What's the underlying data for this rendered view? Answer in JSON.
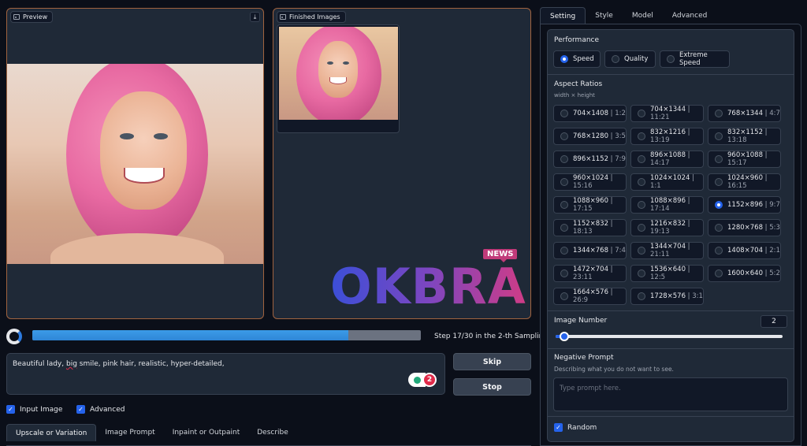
{
  "preview": {
    "label": "Preview"
  },
  "finished": {
    "label": "Finished Images"
  },
  "watermark": {
    "tag": "NEWS",
    "brand": "OKBRA"
  },
  "progress": {
    "fraction": 0.813,
    "step_text": "Step 17/30 in the 2-th Sampling"
  },
  "prompt": {
    "text_before": "Beautiful lady, ",
    "text_underlined": "big",
    "text_after": " smile, pink hair, realistic, hyper-detailed,",
    "badge_count": "2"
  },
  "buttons": {
    "skip": "Skip",
    "stop": "Stop"
  },
  "checks": {
    "input_image": "Input Image",
    "advanced": "Advanced"
  },
  "bottom_tabs": [
    "Upscale or Variation",
    "Image Prompt",
    "Inpaint or Outpaint",
    "Describe"
  ],
  "right_tabs": [
    "Setting",
    "Style",
    "Model",
    "Advanced"
  ],
  "performance": {
    "title": "Performance",
    "options": [
      "Speed",
      "Quality",
      "Extreme Speed"
    ],
    "selected": 0
  },
  "aspect": {
    "title": "Aspect Ratios",
    "subtitle": "width × height",
    "selected": 14,
    "options": [
      {
        "size": "704×1408",
        "ratio": "1:2"
      },
      {
        "size": "704×1344",
        "ratio": "11:21"
      },
      {
        "size": "768×1344",
        "ratio": "4:7"
      },
      {
        "size": "768×1280",
        "ratio": "3:5"
      },
      {
        "size": "832×1216",
        "ratio": "13:19"
      },
      {
        "size": "832×1152",
        "ratio": "13:18"
      },
      {
        "size": "896×1152",
        "ratio": "7:9"
      },
      {
        "size": "896×1088",
        "ratio": "14:17"
      },
      {
        "size": "960×1088",
        "ratio": "15:17"
      },
      {
        "size": "960×1024",
        "ratio": "15:16"
      },
      {
        "size": "1024×1024",
        "ratio": "1:1"
      },
      {
        "size": "1024×960",
        "ratio": "16:15"
      },
      {
        "size": "1088×960",
        "ratio": "17:15"
      },
      {
        "size": "1088×896",
        "ratio": "17:14"
      },
      {
        "size": "1152×896",
        "ratio": "9:7"
      },
      {
        "size": "1152×832",
        "ratio": "18:13"
      },
      {
        "size": "1216×832",
        "ratio": "19:13"
      },
      {
        "size": "1280×768",
        "ratio": "5:3"
      },
      {
        "size": "1344×768",
        "ratio": "7:4"
      },
      {
        "size": "1344×704",
        "ratio": "21:11"
      },
      {
        "size": "1408×704",
        "ratio": "2:1"
      },
      {
        "size": "1472×704",
        "ratio": "23:11"
      },
      {
        "size": "1536×640",
        "ratio": "12:5"
      },
      {
        "size": "1600×640",
        "ratio": "5:2"
      },
      {
        "size": "1664×576",
        "ratio": "26:9"
      },
      {
        "size": "1728×576",
        "ratio": "3:1"
      }
    ]
  },
  "image_number": {
    "title": "Image Number",
    "value": "2",
    "fraction": 0.03
  },
  "negative": {
    "title": "Negative Prompt",
    "subtitle": "Describing what you do not want to see.",
    "placeholder": "Type prompt here."
  },
  "random": {
    "label": "Random"
  },
  "colors": {
    "accent": "#2563eb",
    "panel_border": "#a0633f",
    "progress": "#3b9be8"
  }
}
